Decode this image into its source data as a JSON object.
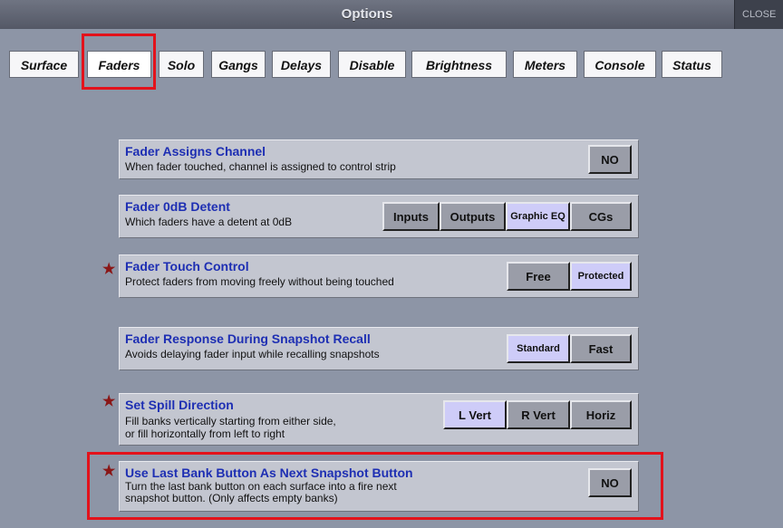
{
  "window": {
    "title": "Options",
    "close_label": "CLOSE"
  },
  "tabs": [
    {
      "label": "Surface"
    },
    {
      "label": "Faders",
      "active": true
    },
    {
      "label": "Solo"
    },
    {
      "label": "Gangs"
    },
    {
      "label": "Delays"
    },
    {
      "label": "Disable"
    },
    {
      "label": "Brightness"
    },
    {
      "label": "Meters"
    },
    {
      "label": "Console"
    },
    {
      "label": "Status"
    }
  ],
  "options": [
    {
      "title": "Fader Assigns Channel",
      "description": [
        "When fader touched, channel is assigned to control strip"
      ],
      "starred": false,
      "buttons": [
        {
          "label": "NO",
          "selected": false
        }
      ]
    },
    {
      "title": "Fader 0dB Detent",
      "description": [
        "Which faders have a detent at 0dB"
      ],
      "starred": false,
      "buttons": [
        {
          "label": "Inputs",
          "selected": false
        },
        {
          "label": "Outputs",
          "selected": false
        },
        {
          "label": "Graphic EQ",
          "selected": true
        },
        {
          "label": "CGs",
          "selected": false
        }
      ]
    },
    {
      "title": "Fader Touch Control",
      "description": [
        "Protect faders from moving freely without being touched"
      ],
      "starred": true,
      "buttons": [
        {
          "label": "Free",
          "selected": false
        },
        {
          "label": "Protected",
          "selected": true
        }
      ]
    },
    {
      "title": "Fader Response During Snapshot Recall",
      "description": [
        "Avoids delaying fader input while recalling snapshots"
      ],
      "starred": false,
      "buttons": [
        {
          "label": "Standard",
          "selected": true
        },
        {
          "label": "Fast",
          "selected": false
        }
      ]
    },
    {
      "title": "Set Spill Direction",
      "description": [
        "Fill banks vertically starting from either side,",
        "or fill horizontally from left to right"
      ],
      "starred": true,
      "buttons": [
        {
          "label": "L Vert",
          "selected": true
        },
        {
          "label": "R Vert",
          "selected": false
        },
        {
          "label": "Horiz",
          "selected": false
        }
      ]
    },
    {
      "title": "Use Last Bank Button As Next Snapshot Button",
      "description": [
        "Turn the last bank button on each surface into a fire next",
        "snapshot button. (Only affects empty banks)"
      ],
      "starred": true,
      "buttons": [
        {
          "label": "NO",
          "selected": false
        }
      ]
    }
  ],
  "colors": {
    "selected_button": "#ceccf8",
    "unselected_button": "#9a9da8",
    "title_text": "#1e2fb3",
    "highlight": "#e3121b",
    "star": "#8a1616"
  }
}
